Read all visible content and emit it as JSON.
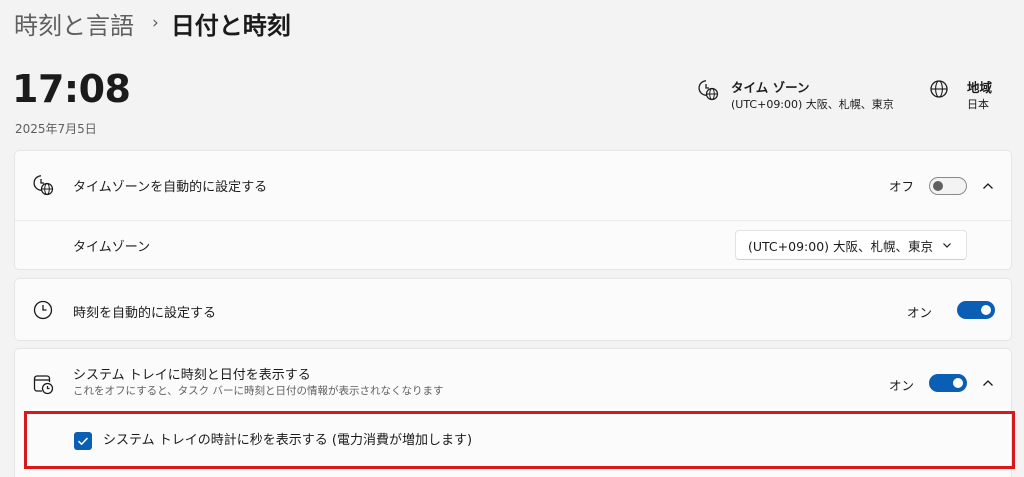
{
  "breadcrumb": {
    "parent": "時刻と言語",
    "separator": "›",
    "current": "日付と時刻"
  },
  "clock": {
    "time": "17:08",
    "date": "2025年7月5日"
  },
  "header_info": {
    "timezone": {
      "icon": "clock-globe-icon",
      "title": "タイム ゾーン",
      "value": "(UTC+09:00) 大阪、札幌、東京"
    },
    "region": {
      "icon": "globe-icon",
      "title": "地域",
      "value": "日本"
    }
  },
  "settings": {
    "auto_timezone": {
      "icon": "clock-globe-icon",
      "label": "タイムゾーンを自動的に設定する",
      "state_text": "オフ",
      "enabled": false,
      "expanded": true,
      "timezone_row": {
        "label": "タイムゾーン",
        "selected": "(UTC+09:00) 大阪、札幌、東京"
      }
    },
    "auto_time": {
      "icon": "clock-icon",
      "label": "時刻を自動的に設定する",
      "state_text": "オン",
      "enabled": true
    },
    "tray_clock": {
      "icon": "calendar-clock-icon",
      "label": "システム トレイに時刻と日付を表示する",
      "description": "これをオフにすると、タスク バーに時刻と日付の情報が表示されなくなります",
      "state_text": "オン",
      "enabled": true,
      "expanded": true,
      "show_seconds": {
        "checked": true,
        "label": "システム トレイの時計に秒を表示する (電力消費が増加します)"
      }
    }
  },
  "colors": {
    "accent": "#0a5fb4",
    "highlight_border": "#d7191f",
    "background": "#f3f3f3",
    "card": "#fbfbfb"
  }
}
